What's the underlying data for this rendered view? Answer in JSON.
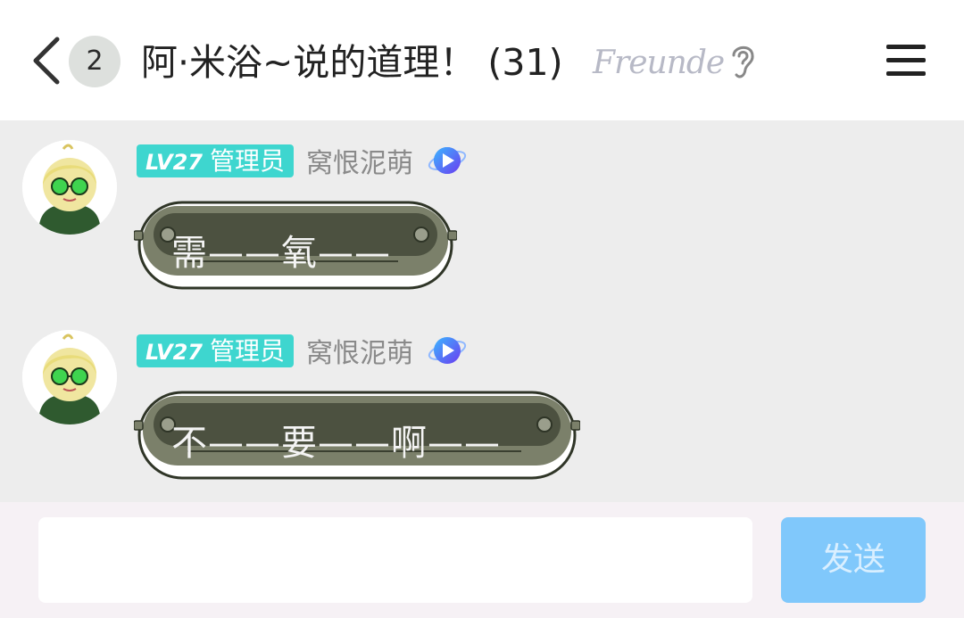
{
  "header": {
    "unread_count": "2",
    "title": "阿·米浴~说的道理！ (31)",
    "badge_logo_text": "Freunde",
    "back_icon": "chevron-left-icon",
    "ear_icon": "ear-icon",
    "menu_icon": "hamburger-menu-icon"
  },
  "messages": [
    {
      "level": "LV27",
      "role": "管理员",
      "sender": "窝恨泥萌",
      "text": "需——氧——"
    },
    {
      "level": "LV27",
      "role": "管理员",
      "sender": "窝恨泥萌",
      "text": "不——要——啊——"
    }
  ],
  "input_bar": {
    "placeholder": "",
    "send_label": "发送"
  },
  "colors": {
    "level_tag": "#3ed6cf",
    "send_button": "#80c8fb",
    "bubble_fill": "#5f6550",
    "chat_background": "#ededed"
  }
}
